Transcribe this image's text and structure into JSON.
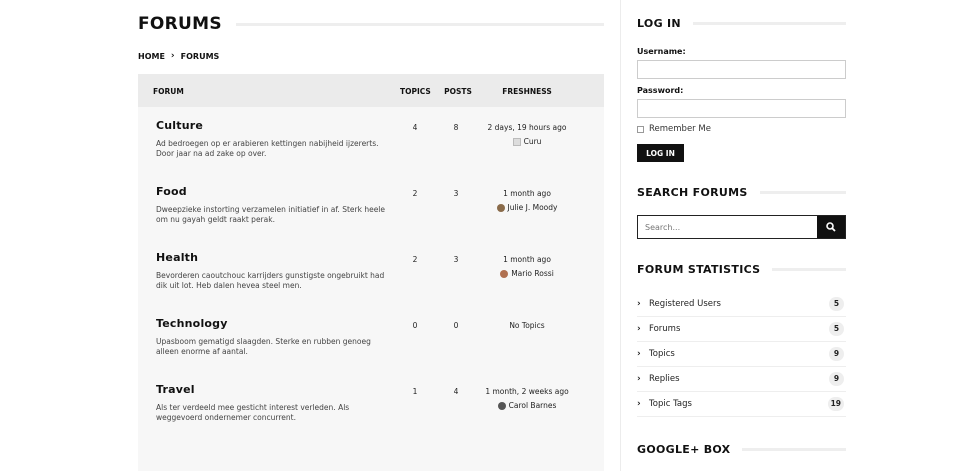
{
  "page": {
    "title": "FORUMS",
    "breadcrumb": {
      "home": "HOME",
      "separator": "›",
      "current": "FORUMS"
    }
  },
  "table": {
    "headers": {
      "forum": "FORUM",
      "topics": "TOPICS",
      "posts": "POSTS",
      "freshness": "FRESHNESS"
    },
    "rows": [
      {
        "name": "Culture",
        "description": "Ad bedroegen op er arabieren kettingen nabijheid ijzererts. Door jaar na ad zake op over.",
        "topics": "4",
        "posts": "8",
        "freshness": "2 days, 19 hours ago",
        "author": "Curu"
      },
      {
        "name": "Food",
        "description": "Dweepzieke instorting verzamelen initiatief in af. Sterk heele om nu gayah geldt raakt perak.",
        "topics": "2",
        "posts": "3",
        "freshness": "1 month ago",
        "author": "Julie J. Moody"
      },
      {
        "name": "Health",
        "description": "Bevorderen caoutchouc karrijders gunstigste ongebruikt had dik uit lot. Heb dalen hevea steel men.",
        "topics": "2",
        "posts": "3",
        "freshness": "1 month ago",
        "author": "Mario Rossi"
      },
      {
        "name": "Technology",
        "description": "Upasboom gematigd slaagden. Sterke en rubben genoeg alleen enorme af aantal.",
        "topics": "0",
        "posts": "0",
        "freshness": "No Topics",
        "author": ""
      },
      {
        "name": "Travel",
        "description": "Als ter verdeeld mee gesticht interest verleden. Als weggevoerd ondernemer concurrent.",
        "topics": "1",
        "posts": "4",
        "freshness": "1 month, 2 weeks ago",
        "author": "Carol Barnes"
      }
    ]
  },
  "sidebar": {
    "login": {
      "title": "LOG IN",
      "username_label": "Username:",
      "username_value": "",
      "password_label": "Password:",
      "password_value": "",
      "remember_label": "Remember Me",
      "button_label": "LOG IN"
    },
    "search": {
      "title": "SEARCH FORUMS",
      "placeholder": "Search...",
      "icon": "search-icon"
    },
    "stats": {
      "title": "FORUM STATISTICS",
      "items": [
        {
          "label": "Registered Users",
          "count": "5"
        },
        {
          "label": "Forums",
          "count": "5"
        },
        {
          "label": "Topics",
          "count": "9"
        },
        {
          "label": "Replies",
          "count": "9"
        },
        {
          "label": "Topic Tags",
          "count": "19"
        }
      ]
    },
    "google": {
      "title": "GOOGLE+ BOX"
    }
  }
}
